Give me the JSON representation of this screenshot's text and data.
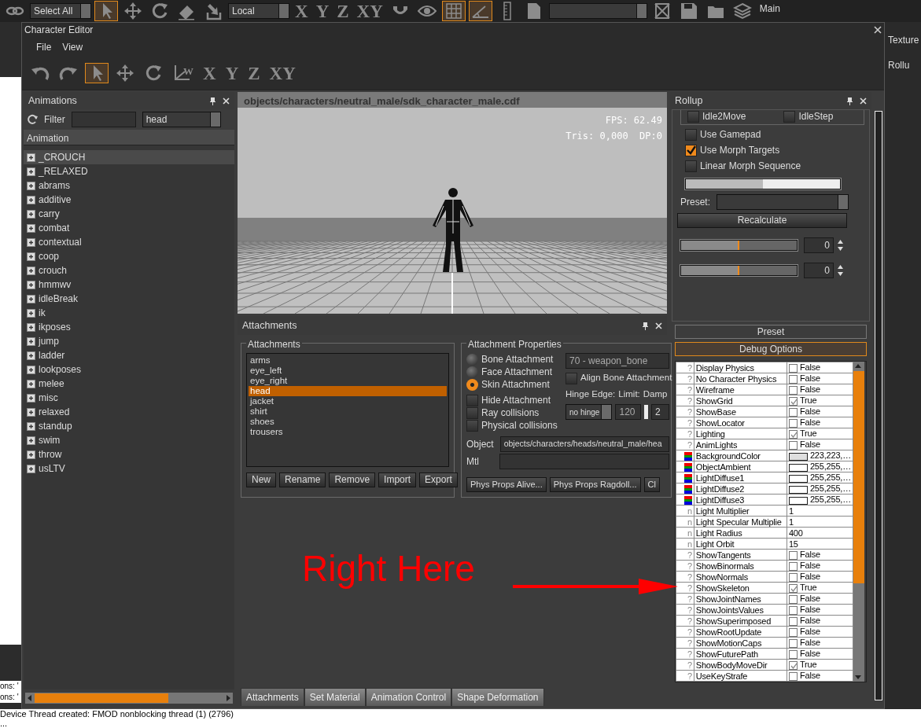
{
  "app_toolbar": [
    {
      "kind": "chain",
      "selected": false
    },
    {
      "kind": "dropdown",
      "label": "Select All"
    },
    {
      "kind": "select",
      "selected": true
    },
    {
      "kind": "move",
      "selected": false
    },
    {
      "kind": "rotate",
      "selected": false
    },
    {
      "kind": "eraser",
      "selected": false
    },
    {
      "kind": "drop",
      "selected": false
    },
    {
      "kind": "dropdown",
      "label": "Local"
    },
    {
      "kind": "letter",
      "label": "X",
      "selected": false
    },
    {
      "kind": "letter",
      "label": "Y",
      "selected": false
    },
    {
      "kind": "letter",
      "label": "Z",
      "selected": false
    },
    {
      "kind": "letter",
      "label": "XY",
      "selected": false
    },
    {
      "kind": "magnet",
      "selected": false
    },
    {
      "kind": "eye",
      "selected": false
    },
    {
      "kind": "grid",
      "selected": true
    },
    {
      "kind": "angle",
      "selected": true
    },
    {
      "kind": "ruler",
      "selected": false
    },
    {
      "kind": "doc",
      "selected": false
    },
    {
      "kind": "dropdown"
    },
    {
      "kind": "cross",
      "selected": false
    },
    {
      "kind": "save",
      "selected": false
    },
    {
      "kind": "folder",
      "selected": false
    },
    {
      "kind": "layers",
      "selected": false
    },
    {
      "kind": "text",
      "label": "Main",
      "selected": false
    }
  ],
  "window": {
    "title": "Character Editor"
  },
  "menu": [
    "File",
    "View"
  ],
  "toolbar": [
    {
      "kind": "undo",
      "selected": false
    },
    {
      "kind": "redo",
      "selected": false
    },
    {
      "kind": "select",
      "selected": true
    },
    {
      "kind": "move",
      "selected": false
    },
    {
      "kind": "rotate",
      "selected": false
    },
    {
      "kind": "axes",
      "label": "W",
      "selected": false
    },
    {
      "kind": "letter",
      "label": "X",
      "selected": false
    },
    {
      "kind": "letter",
      "label": "Y",
      "selected": false
    },
    {
      "kind": "letter",
      "label": "Z",
      "selected": false
    },
    {
      "kind": "letter",
      "label": "XY",
      "selected": false
    }
  ],
  "animations": {
    "title": "Animations",
    "filter_label": "Filter",
    "dropdown": "head",
    "column": "Animation",
    "items": [
      {
        "label": "_CROUCH",
        "selected": true
      },
      {
        "label": "_RELAXED",
        "selected": false
      },
      {
        "label": "abrams",
        "selected": false
      },
      {
        "label": "additive",
        "selected": false
      },
      {
        "label": "carry",
        "selected": false
      },
      {
        "label": "combat",
        "selected": false
      },
      {
        "label": "contextual",
        "selected": false
      },
      {
        "label": "coop",
        "selected": false
      },
      {
        "label": "crouch",
        "selected": false
      },
      {
        "label": "hmmwv",
        "selected": false
      },
      {
        "label": "idleBreak",
        "selected": false
      },
      {
        "label": "ik",
        "selected": false
      },
      {
        "label": "ikposes",
        "selected": false
      },
      {
        "label": "jump",
        "selected": false
      },
      {
        "label": "ladder",
        "selected": false
      },
      {
        "label": "lookposes",
        "selected": false
      },
      {
        "label": "melee",
        "selected": false
      },
      {
        "label": "misc",
        "selected": false
      },
      {
        "label": "relaxed",
        "selected": false
      },
      {
        "label": "standup",
        "selected": false
      },
      {
        "label": "swim",
        "selected": false
      },
      {
        "label": "throw",
        "selected": false
      },
      {
        "label": "usLTV",
        "selected": false
      }
    ]
  },
  "viewport": {
    "title": "objects/characters/neutral_male/sdk_character_male.cdf",
    "stats": [
      "FPS: 62.49",
      "Tris: 0,000  DP:0"
    ]
  },
  "attachments": {
    "title": "Attachments",
    "list_title": "Attachments",
    "items": [
      {
        "label": "arms",
        "selected": false
      },
      {
        "label": "eye_left",
        "selected": false
      },
      {
        "label": "eye_right",
        "selected": false
      },
      {
        "label": "head",
        "selected": true
      },
      {
        "label": "jacket",
        "selected": false
      },
      {
        "label": "shirt",
        "selected": false
      },
      {
        "label": "shoes",
        "selected": false
      },
      {
        "label": "trousers",
        "selected": false
      }
    ],
    "buttons": [
      "New",
      "Rename",
      "Remove",
      "Import",
      "Export"
    ],
    "properties": {
      "title": "Attachment Properties",
      "radios": [
        {
          "label": "Bone Attachment",
          "selected": false
        },
        {
          "label": "Face Attachment",
          "selected": false
        },
        {
          "label": "Skin Attachment",
          "selected": true
        }
      ],
      "bone_dropdown": "70 - weapon_bone",
      "align": {
        "label": "Align Bone Attachment",
        "checked": false
      },
      "checkboxes": [
        {
          "label": "Hide Attachment",
          "checked": false
        },
        {
          "label": "Ray collisions",
          "checked": false
        },
        {
          "label": "Physical collisions",
          "checked": false
        }
      ],
      "hinge_label": "Hinge Edge:",
      "limit_label": "Limit:",
      "damp_label": "Damp",
      "hinge_value": "no hinge",
      "limit_value": "120",
      "damp_value": "2",
      "object_label": "Object",
      "object_value": "objects/characters/heads/neutral_male/hea",
      "mtl_label": "Mtl",
      "buttons": [
        "Phys Props Alive...",
        "Phys Props Ragdoll...",
        "Cl"
      ]
    }
  },
  "bottom_tabs": [
    {
      "label": "Attachments",
      "selected": true
    },
    {
      "label": "Set Material",
      "selected": false
    },
    {
      "label": "Animation Control",
      "selected": false
    },
    {
      "label": "Shape Deformation",
      "selected": false
    }
  ],
  "rollup": {
    "title": "Rollup",
    "partial_checkboxes": [
      {
        "label": "Idle2Move",
        "checked": false
      },
      {
        "label": "IdleStep",
        "checked": false
      }
    ],
    "checkboxes": [
      {
        "label": "Use Gamepad",
        "checked": false
      },
      {
        "label": "Use Morph Targets",
        "checked": true
      },
      {
        "label": "Linear Morph Sequence",
        "checked": false
      }
    ],
    "morph_bar": {
      "level": 0.5
    },
    "preset_label": "Preset:",
    "recalculate": "Recalculate",
    "sliders": [
      {
        "level": 0.5,
        "value": "0"
      },
      {
        "level": 0.5,
        "value": "0"
      }
    ],
    "sections": [
      {
        "label": "Preset",
        "selected": false
      },
      {
        "label": "Debug Options",
        "selected": true
      }
    ],
    "properties": [
      {
        "kind": "bool",
        "type_mark": "?",
        "name": "Display Physics",
        "value": "False",
        "checked": false
      },
      {
        "kind": "bool",
        "type_mark": "?",
        "name": "No Character Physics",
        "value": "False",
        "checked": false
      },
      {
        "kind": "bool",
        "type_mark": "?",
        "name": "Wireframe",
        "value": "False",
        "checked": false
      },
      {
        "kind": "bool",
        "type_mark": "?",
        "name": "ShowGrid",
        "value": "True",
        "checked": true
      },
      {
        "kind": "bool",
        "type_mark": "?",
        "name": "ShowBase",
        "value": "False",
        "checked": false
      },
      {
        "kind": "bool",
        "type_mark": "?",
        "name": "ShowLocator",
        "value": "False",
        "checked": false
      },
      {
        "kind": "bool",
        "type_mark": "?",
        "name": "Lighting",
        "value": "True",
        "checked": true
      },
      {
        "kind": "bool",
        "type_mark": "?",
        "name": "AnimLights",
        "value": "False",
        "checked": false
      },
      {
        "kind": "color",
        "name": "BackgroundColor",
        "value": "223,223,…",
        "color": "#dfdfdf"
      },
      {
        "kind": "color",
        "name": "ObjectAmbient",
        "value": "255,255,…",
        "color": "#ffffff"
      },
      {
        "kind": "color",
        "name": "LightDiffuse1",
        "value": "255,255,…",
        "color": "#ffffff"
      },
      {
        "kind": "color",
        "name": "LightDiffuse2",
        "value": "255,255,…",
        "color": "#ffffff"
      },
      {
        "kind": "color",
        "name": "LightDiffuse3",
        "value": "255,255,…",
        "color": "#ffffff"
      },
      {
        "kind": "number",
        "type_mark": "n",
        "name": "Light Multiplier",
        "value": "1"
      },
      {
        "kind": "number",
        "type_mark": "n",
        "name": "Light Specular Multiplie",
        "value": "1"
      },
      {
        "kind": "number",
        "type_mark": "n",
        "name": "Light Radius",
        "value": "400"
      },
      {
        "kind": "number",
        "type_mark": "n",
        "name": "Light Orbit",
        "value": "15"
      },
      {
        "kind": "bool",
        "type_mark": "?",
        "name": "ShowTangents",
        "value": "False",
        "checked": false
      },
      {
        "kind": "bool",
        "type_mark": "?",
        "name": "ShowBinormals",
        "value": "False",
        "checked": false
      },
      {
        "kind": "bool",
        "type_mark": "?",
        "name": "ShowNormals",
        "value": "False",
        "checked": false
      },
      {
        "kind": "bool",
        "type_mark": "?",
        "name": "ShowSkeleton",
        "value": "True",
        "checked": true
      },
      {
        "kind": "bool",
        "type_mark": "?",
        "name": "ShowJointNames",
        "value": "False",
        "checked": false
      },
      {
        "kind": "bool",
        "type_mark": "?",
        "name": "ShowJointsValues",
        "value": "False",
        "checked": false
      },
      {
        "kind": "bool",
        "type_mark": "?",
        "name": "ShowSuperimposed",
        "value": "False",
        "checked": false
      },
      {
        "kind": "bool",
        "type_mark": "?",
        "name": "ShowRootUpdate",
        "value": "False",
        "checked": false
      },
      {
        "kind": "bool",
        "type_mark": "?",
        "name": "ShowMotionCaps",
        "value": "False",
        "checked": false
      },
      {
        "kind": "bool",
        "type_mark": "?",
        "name": "ShowFuturePath",
        "value": "False",
        "checked": false
      },
      {
        "kind": "bool",
        "type_mark": "?",
        "name": "ShowBodyMoveDir",
        "value": "True",
        "checked": true
      },
      {
        "kind": "bool",
        "type_mark": "?",
        "name": "UseKeyStrafe",
        "value": "False",
        "checked": false
      }
    ]
  },
  "right_strip": [
    "Texture",
    "Rollu"
  ],
  "side_log": [
    "ons: '",
    "ons: '"
  ],
  "log": [
    "Device Thread created: FMOD nonblocking thread (1) (2796)",
    "..."
  ],
  "annotation": {
    "text": "Right Here"
  }
}
